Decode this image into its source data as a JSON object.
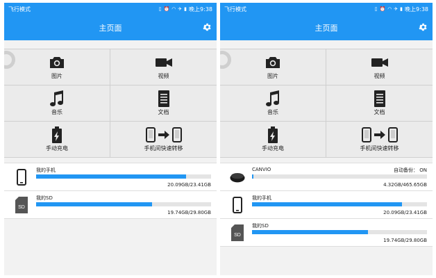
{
  "status_bar": {
    "mode": "飞行模式",
    "clock": "晚上9:38"
  },
  "app_bar": {
    "title": "主页面",
    "settings_icon": "gear-icon"
  },
  "categories": [
    {
      "label": "图片",
      "icon": "camera-icon"
    },
    {
      "label": "视频",
      "icon": "video-camera-icon"
    },
    {
      "label": "音乐",
      "icon": "music-note-icon"
    },
    {
      "label": "文档",
      "icon": "document-icon"
    },
    {
      "label": "手动充电",
      "icon": "battery-charge-icon"
    },
    {
      "label": "手机间快速转移",
      "icon": "phone-transfer-icon"
    }
  ],
  "screens": [
    {
      "storage": [
        {
          "name": "我的手机",
          "size": "20.09GB/23.41GB",
          "used_fraction": 0.858,
          "icon": "phone-icon"
        },
        {
          "name": "我的SD",
          "size": "19.74GB/29.80GB",
          "used_fraction": 0.662,
          "icon": "sd-card-icon",
          "icon_text": "SD"
        }
      ]
    },
    {
      "storage": [
        {
          "name": "CANVIO",
          "backup": "自动备份： ON",
          "size": "4.32GB/465.65GB",
          "used_fraction": 0.009,
          "icon": "external-drive-icon"
        },
        {
          "name": "我的手机",
          "size": "20.09GB/23.41GB",
          "used_fraction": 0.858,
          "icon": "phone-icon"
        },
        {
          "name": "我的SD",
          "size": "19.74GB/29.80GB",
          "used_fraction": 0.662,
          "icon": "sd-card-icon",
          "icon_text": "SD"
        }
      ]
    }
  ],
  "colors": {
    "accent": "#2196f3",
    "tile_bg": "#ebebeb",
    "track": "#e4e4e4"
  }
}
